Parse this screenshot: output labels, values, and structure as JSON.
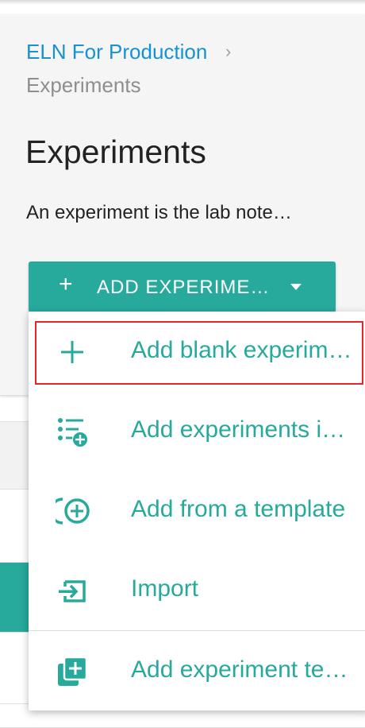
{
  "breadcrumb": {
    "link": "ELN For Production",
    "separator": "›",
    "current": "Experiments"
  },
  "header": {
    "title": "Experiments",
    "description": "An experiment is the lab note…"
  },
  "add_button": {
    "plus": "+",
    "label": "ADD EXPERIME…"
  },
  "dropdown": {
    "items": [
      {
        "label": "Add blank experim…",
        "icon": "plus-icon",
        "highlighted": true
      },
      {
        "label": "Add experiments i…",
        "icon": "list-add-icon"
      },
      {
        "label": "Add from a template",
        "icon": "template-add-icon"
      },
      {
        "label": "Import",
        "icon": "import-icon"
      },
      {
        "label": "Add experiment te…",
        "icon": "copy-add-icon"
      }
    ]
  },
  "colors": {
    "accent": "#27a99c",
    "link": "#1591d4",
    "highlight_border": "#e8242b"
  }
}
